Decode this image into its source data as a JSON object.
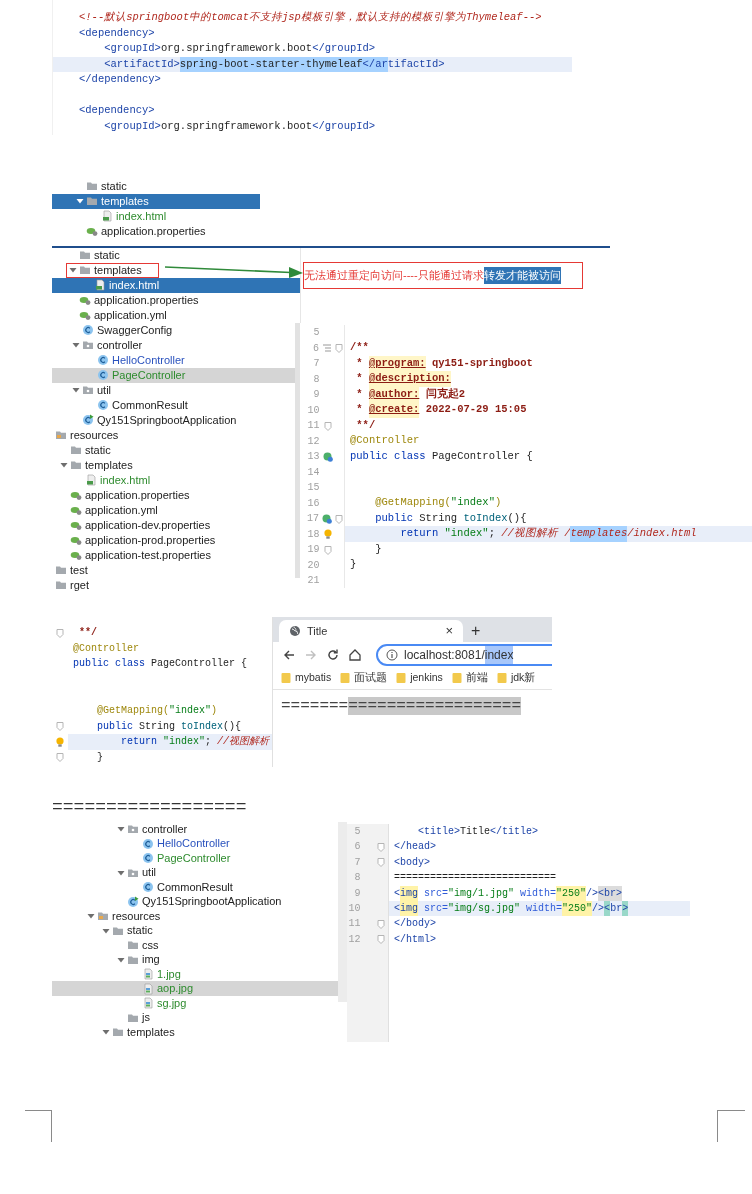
{
  "xml_snippet": {
    "lines": [
      {
        "current": false,
        "tokens": [
          {
            "text": "<!--默认springboot中的tomcat不支持jsp模板引擎，默认支持的模板引擎为Thymeleaf-->",
            "kind": "comment"
          }
        ]
      },
      {
        "current": false,
        "tokens": [
          {
            "text": "<dependency>",
            "kind": "tag"
          }
        ]
      },
      {
        "current": false,
        "tokens": [
          {
            "text": "    <groupId>",
            "kind": "tag"
          },
          {
            "text": "org.springframework.boot",
            "kind": "plain"
          },
          {
            "text": "</groupId>",
            "kind": "tag"
          }
        ]
      },
      {
        "current": true,
        "tokens": [
          {
            "text": "    <artifactId>",
            "kind": "tag"
          },
          {
            "text": "spring-boot-starter-thymeleaf",
            "kind": "plainsel"
          },
          {
            "text": "</ar",
            "kind": "tagsel"
          },
          {
            "text": "tifactId>",
            "kind": "tag"
          }
        ]
      },
      {
        "current": false,
        "tokens": [
          {
            "text": "</dependency>",
            "kind": "tag"
          }
        ]
      },
      {
        "current": false
      },
      {
        "current": false,
        "tokens": [
          {
            "text": "<dependency>",
            "kind": "tag"
          }
        ]
      },
      {
        "current": false,
        "tokens": [
          {
            "text": "    <groupId>",
            "kind": "tag"
          },
          {
            "text": "org.springframework.boot",
            "kind": "plain"
          },
          {
            "text": "</groupId>",
            "kind": "tag"
          }
        ]
      }
    ]
  },
  "tree_snippet": {
    "focused": true,
    "sections": [
      {
        "items": [
          {
            "label": "static",
            "kind": "folder",
            "selected": false
          },
          {
            "label": "templates",
            "kind": "folder",
            "selected": true,
            "expanded": true,
            "children": [
              {
                "label": "index.html",
                "kind": "html",
                "color": "#2e8b2e",
                "selected": false
              }
            ]
          },
          {
            "label": "application.properties",
            "kind": "config",
            "selected": false
          }
        ]
      }
    ]
  },
  "annotated_capture": {
    "tree": {
      "focused": true,
      "sections": [
        {
          "items": [
            {
              "label": "static",
              "kind": "folder",
              "selected": false,
              "framed": false
            },
            {
              "label": "templates",
              "kind": "folder",
              "selected": false,
              "framed": true,
              "expanded": true,
              "children": [
                {
                  "label": "index.html",
                  "kind": "html",
                  "selected": true,
                  "framed": false
                }
              ]
            },
            {
              "label": "application.properties",
              "kind": "config",
              "selected": false,
              "framed": false
            },
            {
              "label": "application.yml",
              "kind": "config",
              "selected": false,
              "framed": false
            }
          ]
        }
      ]
    },
    "note": [
      {
        "text": "无法通过重定向访问----只能通过请求",
        "selected": false
      },
      {
        "text": "转发才能被访问",
        "selected": true
      }
    ],
    "project_tree": {
      "focused": false,
      "sections": [
        {
          "items": [
            {
              "label": "SwaggerConfig",
              "kind": "class",
              "selected": false
            },
            {
              "label": "controller",
              "kind": "package",
              "selected": false,
              "expanded": true,
              "children": [
                {
                  "label": "HelloController",
                  "kind": "class",
                  "color": "#2a52be",
                  "selected": false
                },
                {
                  "label": "PageController",
                  "kind": "class",
                  "color": "#2e8b2e",
                  "selected": true
                }
              ]
            },
            {
              "label": "util",
              "kind": "package",
              "selected": false,
              "expanded": true,
              "children": [
                {
                  "label": "CommonResult",
                  "kind": "class",
                  "selected": false
                }
              ]
            },
            {
              "label": "Qy151SpringbootApplication",
              "kind": "app",
              "selected": false
            }
          ]
        },
        {
          "items": [
            {
              "label": "resources",
              "kind": "resources",
              "selected": false,
              "children": [
                {
                  "label": "static",
                  "kind": "folder",
                  "selected": false
                },
                {
                  "label": "templates",
                  "kind": "folder",
                  "selected": false,
                  "expanded": true,
                  "children": [
                    {
                      "label": "index.html",
                      "kind": "html",
                      "color": "#2e8b2e",
                      "selected": false
                    }
                  ]
                },
                {
                  "label": "application.properties",
                  "kind": "config",
                  "selected": false
                },
                {
                  "label": "application.yml",
                  "kind": "config",
                  "selected": false
                },
                {
                  "label": "application-dev.properties",
                  "kind": "config",
                  "selected": false
                },
                {
                  "label": "application-prod.properties",
                  "kind": "config",
                  "selected": false
                },
                {
                  "label": "application-test.properties",
                  "kind": "config",
                  "selected": false
                }
              ]
            },
            {
              "label": "test",
              "kind": "folder",
              "selected": false
            },
            {
              "label": "rget",
              "kind": "folder",
              "selected": false
            }
          ]
        }
      ]
    },
    "editor": {
      "lines": [
        {
          "number": "5",
          "current": false
        },
        {
          "number": "6",
          "current": false,
          "marks": [
            {
              "kind": "structure"
            },
            {
              "kind": "fold"
            }
          ],
          "tokens": [
            {
              "text": "/**",
              "kind": "doc"
            }
          ]
        },
        {
          "number": "7",
          "current": false,
          "tokens": [
            {
              "text": " * ",
              "kind": "doc"
            },
            {
              "text": "@program:",
              "kind": "doctag"
            },
            {
              "text": " qy151-springboot",
              "kind": "doc"
            }
          ]
        },
        {
          "number": "8",
          "current": false,
          "tokens": [
            {
              "text": " * ",
              "kind": "doc"
            },
            {
              "text": "@description:",
              "kind": "doctag"
            }
          ]
        },
        {
          "number": "9",
          "current": false,
          "tokens": [
            {
              "text": " * ",
              "kind": "doc"
            },
            {
              "text": "@author:",
              "kind": "doctag"
            },
            {
              "text": " 闫克起2",
              "kind": "doc"
            }
          ]
        },
        {
          "number": "10",
          "current": false,
          "tokens": [
            {
              "text": " * ",
              "kind": "doc"
            },
            {
              "text": "@create:",
              "kind": "doctag"
            },
            {
              "text": " 2022-07-29 15:05",
              "kind": "doc"
            }
          ]
        },
        {
          "number": "11",
          "current": false,
          "marks": [
            {
              "kind": "fold"
            }
          ],
          "tokens": [
            {
              "text": " **/",
              "kind": "doc"
            }
          ]
        },
        {
          "number": "12",
          "current": false,
          "tokens": [
            {
              "text": "@Controller",
              "kind": "annot"
            }
          ]
        },
        {
          "number": "13",
          "current": false,
          "marks": [
            {
              "kind": "bean"
            }
          ],
          "tokens": [
            {
              "text": "public class",
              "kind": "kw"
            },
            {
              "text": " PageController {",
              "kind": "plain"
            }
          ]
        },
        {
          "number": "14",
          "current": false
        },
        {
          "number": "15",
          "current": false
        },
        {
          "number": "16",
          "current": false,
          "tokens": [
            {
              "text": "    @GetMapping(",
              "kind": "annot"
            },
            {
              "text": "\"index\"",
              "kind": "str"
            },
            {
              "text": ")",
              "kind": "annot"
            }
          ]
        },
        {
          "number": "17",
          "current": false,
          "marks": [
            {
              "kind": "bean"
            },
            {
              "kind": "fold"
            }
          ],
          "tokens": [
            {
              "text": "    public",
              "kind": "kw"
            },
            {
              "text": " String ",
              "kind": "plain"
            },
            {
              "text": "toIndex",
              "kind": "method"
            },
            {
              "text": "(){",
              "kind": "plain"
            }
          ]
        },
        {
          "number": "18",
          "current": true,
          "marks": [
            {
              "kind": "bulb"
            }
          ],
          "tokens": [
            {
              "text": "        return",
              "kind": "kw"
            },
            {
              "text": " \"index\"",
              "kind": "str"
            },
            {
              "text": "; ",
              "kind": "plain"
            },
            {
              "text": "//视图解析 /",
              "kind": "comment"
            },
            {
              "text": "templates",
              "kind": "commentsel"
            },
            {
              "text": "/index.html",
              "kind": "comment"
            }
          ]
        },
        {
          "number": "19",
          "current": false,
          "marks": [
            {
              "kind": "fold"
            }
          ],
          "tokens": [
            {
              "text": "    }",
              "kind": "plain"
            }
          ]
        },
        {
          "number": "20",
          "current": false,
          "tokens": [
            {
              "text": "}",
              "kind": "plain"
            }
          ]
        },
        {
          "number": "21",
          "current": false
        }
      ]
    }
  },
  "controller_and_browser": {
    "editor": {
      "lines": [
        {
          "current": false,
          "marks": [
            {
              "kind": "fold"
            }
          ],
          "tokens": [
            {
              "text": " **/",
              "kind": "doc"
            }
          ]
        },
        {
          "current": false,
          "tokens": [
            {
              "text": "@Controller",
              "kind": "annot"
            }
          ]
        },
        {
          "current": false,
          "tokens": [
            {
              "text": "public class",
              "kind": "kw"
            },
            {
              "text": " PageController {",
              "kind": "plain"
            }
          ]
        },
        {
          "current": false
        },
        {
          "current": false
        },
        {
          "current": false,
          "tokens": [
            {
              "text": "    @GetMapping(",
              "kind": "annot"
            },
            {
              "text": "\"index\"",
              "kind": "str"
            },
            {
              "text": ")",
              "kind": "annot"
            }
          ]
        },
        {
          "current": false,
          "marks": [
            {
              "kind": "fold"
            }
          ],
          "tokens": [
            {
              "text": "    public",
              "kind": "kw"
            },
            {
              "text": " String ",
              "kind": "plain"
            },
            {
              "text": "toIndex",
              "kind": "method"
            },
            {
              "text": "(){",
              "kind": "plain"
            }
          ]
        },
        {
          "current": true,
          "marks": [
            {
              "kind": "bulb"
            }
          ],
          "tokens": [
            {
              "text": "        return",
              "kind": "kw"
            },
            {
              "text": " \"index\"",
              "kind": "str"
            },
            {
              "text": "; ",
              "kind": "plain"
            },
            {
              "text": "//视图解析",
              "kind": "comment"
            }
          ]
        },
        {
          "current": false,
          "marks": [
            {
              "kind": "fold"
            }
          ],
          "tokens": [
            {
              "text": "    }",
              "kind": "plain"
            }
          ]
        }
      ]
    },
    "browser": {
      "tab_title": "Title",
      "tab_close": "×",
      "new_tab": "+",
      "nav": [
        {
          "kind": "back",
          "disabled": false
        },
        {
          "kind": "forward",
          "disabled": true
        },
        {
          "kind": "reload",
          "disabled": false
        },
        {
          "kind": "home",
          "disabled": false
        }
      ],
      "address": [
        {
          "text": "localhost:8081/",
          "selected": false
        },
        {
          "text": "index",
          "selected": true
        }
      ],
      "bookmarks": [
        "mybatis",
        "面试题",
        "jenkins",
        "前端",
        "jdk新"
      ],
      "page_text": [
        {
          "text": "=======",
          "selected": false
        },
        {
          "text": "==================",
          "selected": true
        }
      ]
    }
  },
  "separator_text": "==================",
  "static_capture": {
    "project_tree": {
      "focused": false,
      "sections": [
        {
          "items": [
            {
              "label": "controller",
              "kind": "package",
              "selected": false,
              "expanded": true,
              "children": [
                {
                  "label": "HelloController",
                  "kind": "class",
                  "color": "#2a52be",
                  "selected": false
                },
                {
                  "label": "PageController",
                  "kind": "class",
                  "color": "#2e8b2e",
                  "selected": false
                }
              ]
            },
            {
              "label": "util",
              "kind": "package",
              "selected": false,
              "expanded": true,
              "children": [
                {
                  "label": "CommonResult",
                  "kind": "class",
                  "selected": false
                }
              ]
            },
            {
              "label": "Qy151SpringbootApplication",
              "kind": "app",
              "selected": false
            }
          ]
        },
        {
          "items": [
            {
              "label": "resources",
              "kind": "resources",
              "selected": false,
              "expanded": true,
              "children": [
                {
                  "label": "static",
                  "kind": "folder",
                  "selected": false,
                  "expanded": true,
                  "children": [
                    {
                      "label": "css",
                      "kind": "folder",
                      "selected": false
                    },
                    {
                      "label": "img",
                      "kind": "folder",
                      "selected": false,
                      "expanded": true,
                      "children": [
                        {
                          "label": "1.jpg",
                          "kind": "image",
                          "color": "#2e8b2e",
                          "selected": false
                        },
                        {
                          "label": "aop.jpg",
                          "kind": "image",
                          "color": "#2e8b2e",
                          "selected": true
                        },
                        {
                          "label": "sg.jpg",
                          "kind": "image",
                          "color": "#2e8b2e",
                          "selected": false
                        }
                      ]
                    },
                    {
                      "label": "js",
                      "kind": "folder",
                      "selected": false
                    }
                  ]
                },
                {
                  "label": "templates",
                  "kind": "folder",
                  "selected": false,
                  "expanded": true
                }
              ]
            }
          ]
        }
      ]
    },
    "editor": {
      "lines": [
        {
          "number": "5",
          "current": false,
          "tokens": [
            {
              "text": "    <title>",
              "kind": "tag"
            },
            {
              "text": "Title",
              "kind": "plain"
            },
            {
              "text": "</title>",
              "kind": "tag"
            }
          ]
        },
        {
          "number": "6",
          "current": false,
          "marks": [
            {
              "kind": "fold"
            }
          ],
          "tokens": [
            {
              "text": "</head>",
              "kind": "tag"
            }
          ]
        },
        {
          "number": "7",
          "current": false,
          "marks": [
            {
              "kind": "fold"
            }
          ],
          "tokens": [
            {
              "text": "<body>",
              "kind": "tag"
            }
          ]
        },
        {
          "number": "8",
          "current": false,
          "tokens": [
            {
              "text": "===========================",
              "kind": "plain"
            }
          ]
        },
        {
          "number": "9",
          "current": false,
          "tokens": [
            {
              "text": "<",
              "kind": "tag"
            },
            {
              "text": "img",
              "kind": "tagwarn"
            },
            {
              "text": " src=",
              "kind": "attr"
            },
            {
              "text": "\"img/1.jpg\"",
              "kind": "str"
            },
            {
              "text": " width=",
              "kind": "attr"
            },
            {
              "text": "\"250\"",
              "kind": "strwarn"
            },
            {
              "text": "/>",
              "kind": "tag"
            },
            {
              "text": "<br>",
              "kind": "tagmatch"
            }
          ]
        },
        {
          "number": "10",
          "current": true,
          "tokens": [
            {
              "text": "<",
              "kind": "tag"
            },
            {
              "text": "img",
              "kind": "tagwarn"
            },
            {
              "text": " src=",
              "kind": "attr"
            },
            {
              "text": "\"img/sg.jpg\"",
              "kind": "str"
            },
            {
              "text": " width=",
              "kind": "attr"
            },
            {
              "text": "\"250\"",
              "kind": "strwarn"
            },
            {
              "text": "/>",
              "kind": "tag"
            },
            {
              "text": "<",
              "kind": "tagpair"
            },
            {
              "text": "br",
              "kind": "tag"
            },
            {
              "text": ">",
              "kind": "tagpair"
            }
          ]
        },
        {
          "number": "11",
          "current": false,
          "marks": [
            {
              "kind": "fold"
            }
          ],
          "tokens": [
            {
              "text": "</body>",
              "kind": "tag"
            }
          ]
        },
        {
          "number": "12",
          "current": false,
          "marks": [
            {
              "kind": "fold"
            }
          ],
          "tokens": [
            {
              "text": "</html>",
              "kind": "tag"
            }
          ]
        }
      ]
    }
  }
}
